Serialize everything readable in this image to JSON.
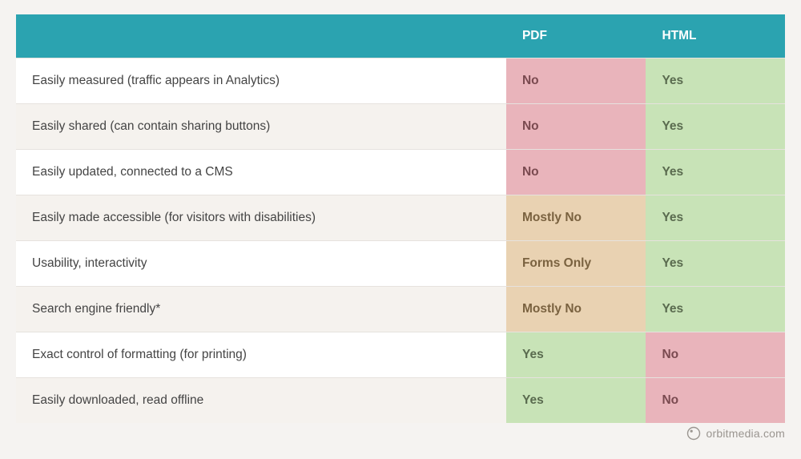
{
  "chart_data": {
    "type": "table",
    "title": "",
    "columns": [
      "",
      "PDF",
      "HTML"
    ],
    "rows": [
      {
        "label": "Easily measured (traffic appears in Analytics)",
        "pdf": "No",
        "html": "Yes"
      },
      {
        "label": "Easily shared (can contain sharing buttons)",
        "pdf": "No",
        "html": "Yes"
      },
      {
        "label": "Easily updated, connected to a CMS",
        "pdf": "No",
        "html": "Yes"
      },
      {
        "label": "Easily made accessible (for visitors with disabilities)",
        "pdf": "Mostly No",
        "html": "Yes"
      },
      {
        "label": "Usability, interactivity",
        "pdf": "Forms Only",
        "html": "Yes"
      },
      {
        "label": "Search engine friendly*",
        "pdf": "Mostly No",
        "html": "Yes"
      },
      {
        "label": "Exact control of formatting (for printing)",
        "pdf": "Yes",
        "html": "No"
      },
      {
        "label": "Easily downloaded, read offline",
        "pdf": "Yes",
        "html": "No"
      }
    ]
  },
  "header": {
    "col1": "",
    "col2": "PDF",
    "col3": "HTML"
  },
  "rows": {
    "0": {
      "label": "Easily measured (traffic appears in Analytics)",
      "pdf": "No",
      "html": "Yes"
    },
    "1": {
      "label": "Easily shared (can contain sharing buttons)",
      "pdf": "No",
      "html": "Yes"
    },
    "2": {
      "label": "Easily updated, connected to a CMS",
      "pdf": "No",
      "html": "Yes"
    },
    "3": {
      "label": "Easily made accessible (for visitors with disabilities)",
      "pdf": "Mostly No",
      "html": "Yes"
    },
    "4": {
      "label": "Usability, interactivity",
      "pdf": "Forms Only",
      "html": "Yes"
    },
    "5": {
      "label": "Search engine friendly*",
      "pdf": "Mostly No",
      "html": "Yes"
    },
    "6": {
      "label": "Exact control of formatting (for printing)",
      "pdf": "Yes",
      "html": "No"
    },
    "7": {
      "label": "Easily downloaded, read offline",
      "pdf": "Yes",
      "html": "No"
    }
  },
  "footer": {
    "credit": "orbitmedia.com"
  },
  "colors": {
    "header": "#2ba3b0",
    "yes": "#c8e3b7",
    "no": "#e9b4bb",
    "partial": "#e9d2b2",
    "page_bg": "#f5f3f1"
  }
}
